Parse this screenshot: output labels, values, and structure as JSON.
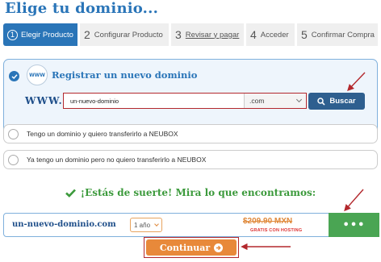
{
  "page_title": "Elige tu dominio...",
  "steps": [
    {
      "num": "1",
      "label": "Elegir Producto"
    },
    {
      "num": "2",
      "label": "Configurar Producto"
    },
    {
      "num": "3",
      "label": "Revisar y pagar"
    },
    {
      "num": "4",
      "label": "Acceder"
    },
    {
      "num": "5",
      "label": "Confirmar Compra"
    }
  ],
  "register": {
    "title": "Registrar un nuevo dominio",
    "badge": "WWW",
    "prefix": "WWW.",
    "domain_value": "un-nuevo-dominio",
    "tld": ".com",
    "search_label": "Buscar"
  },
  "options": [
    {
      "label": "Tengo un dominio y quiero transferirlo a NEUBOX"
    },
    {
      "label": "Ya tengo un dominio pero no quiero transferirlo a NEUBOX"
    }
  ],
  "result": {
    "heading": "¡Estás de suerte! Mira lo que encontramos:",
    "domain": "un-nuevo-dominio.com",
    "years": "1 año",
    "price": "$209.90 MXN",
    "price_note": "GRATIS CON HOSTING",
    "more_label": "•••"
  },
  "continue_label": "Continuar",
  "colors": {
    "brand_blue": "#2a75b8",
    "search_blue": "#2e5f8f",
    "green": "#4aa553",
    "orange": "#e8893a",
    "annotation_red": "#b3282d"
  }
}
